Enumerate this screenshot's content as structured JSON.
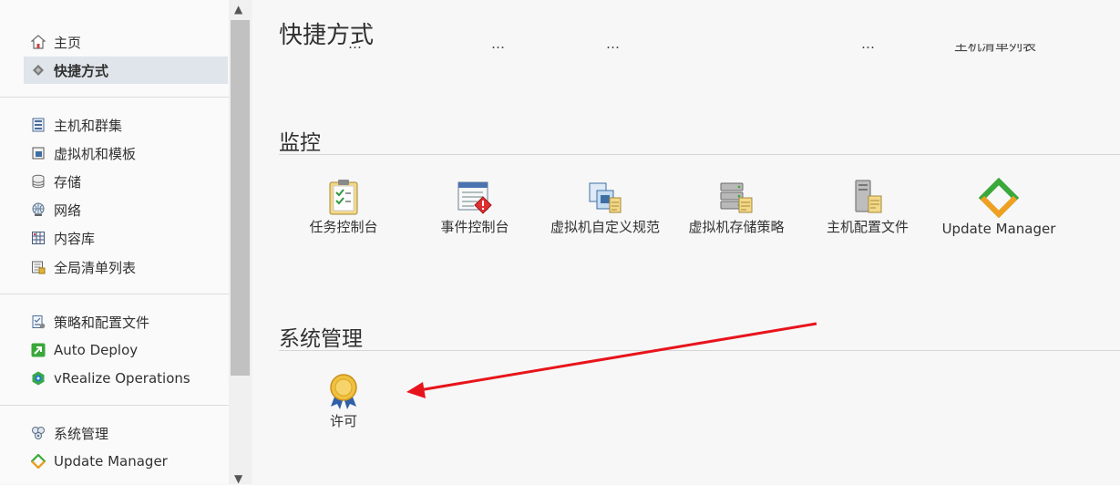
{
  "sidebar": {
    "items": [
      {
        "label": "主页",
        "icon": "home-icon"
      },
      {
        "label": "快捷方式",
        "icon": "shortcuts-icon",
        "selected": true
      },
      {
        "label": "主机和群集",
        "icon": "hosts-clusters-icon"
      },
      {
        "label": "虚拟机和模板",
        "icon": "vms-templates-icon"
      },
      {
        "label": "存储",
        "icon": "storage-icon"
      },
      {
        "label": "网络",
        "icon": "network-icon"
      },
      {
        "label": "内容库",
        "icon": "content-library-icon"
      },
      {
        "label": "全局清单列表",
        "icon": "global-inventory-icon"
      },
      {
        "label": "策略和配置文件",
        "icon": "policies-profiles-icon"
      },
      {
        "label": "Auto Deploy",
        "icon": "auto-deploy-icon"
      },
      {
        "label": "vRealize Operations",
        "icon": "vrealize-operations-icon"
      },
      {
        "label": "系统管理",
        "icon": "administration-icon"
      },
      {
        "label": "Update Manager",
        "icon": "update-manager-icon"
      }
    ]
  },
  "main": {
    "title": "快捷方式",
    "cutoff_labels": [
      "…",
      "…",
      "…",
      "…",
      "主机清单列表"
    ],
    "monitor": {
      "heading": "监控",
      "tiles": [
        {
          "label": "任务控制台",
          "icon": "task-console-icon"
        },
        {
          "label": "事件控制台",
          "icon": "event-console-icon"
        },
        {
          "label": "虚拟机自定义规范",
          "icon": "vm-customization-icon"
        },
        {
          "label": "虚拟机存储策略",
          "icon": "vm-storage-policy-icon"
        },
        {
          "label": "主机配置文件",
          "icon": "host-profile-icon"
        },
        {
          "label": "Update Manager",
          "icon": "update-manager-icon"
        }
      ]
    },
    "admin": {
      "heading": "系统管理",
      "tiles": [
        {
          "label": "许可",
          "icon": "license-icon"
        }
      ]
    }
  },
  "annotation": {
    "color": "#e8141b",
    "points_to": "许可"
  }
}
